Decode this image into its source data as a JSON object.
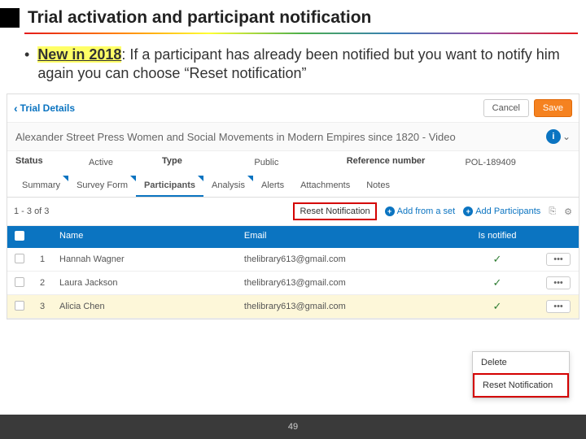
{
  "slide": {
    "title": "Trial activation and participant notification",
    "bullet_lead": "New in 2018",
    "bullet_rest": ": If a participant has already been notified but you want to notify him again you can choose “Reset notification”",
    "page": "49"
  },
  "header": {
    "back_label": "Trial Details",
    "cancel": "Cancel",
    "save": "Save",
    "product_title": "Alexander Street Press Women and Social Movements in Modern Empires since 1820 - Video",
    "info_glyph": "i",
    "chev": "⌄"
  },
  "fields": {
    "status_label": "Status",
    "status_value": "Active",
    "type_label": "Type",
    "type_value": "Public",
    "ref_label": "Reference number",
    "ref_value": "POL-189409"
  },
  "tabs": [
    "Summary",
    "Survey Form",
    "Participants",
    "Analysis",
    "Alerts",
    "Attachments",
    "Notes"
  ],
  "toolbar": {
    "count": "1 - 3 of 3",
    "reset": "Reset Notification",
    "add_set": "Add from a set",
    "add_part": "Add Participants",
    "plus": "+"
  },
  "table": {
    "head": {
      "name": "Name",
      "email": "Email",
      "notified": "Is notified"
    },
    "rows": [
      {
        "n": "1",
        "name": "Hannah Wagner",
        "email": "thelibrary613@gmail.com",
        "notified": "✓"
      },
      {
        "n": "2",
        "name": "Laura Jackson",
        "email": "thelibrary613@gmail.com",
        "notified": "✓"
      },
      {
        "n": "3",
        "name": "Alicia Chen",
        "email": "thelibrary613@gmail.com",
        "notified": "✓"
      }
    ],
    "dots": "•••"
  },
  "menu": {
    "delete": "Delete",
    "reset": "Reset Notification"
  }
}
